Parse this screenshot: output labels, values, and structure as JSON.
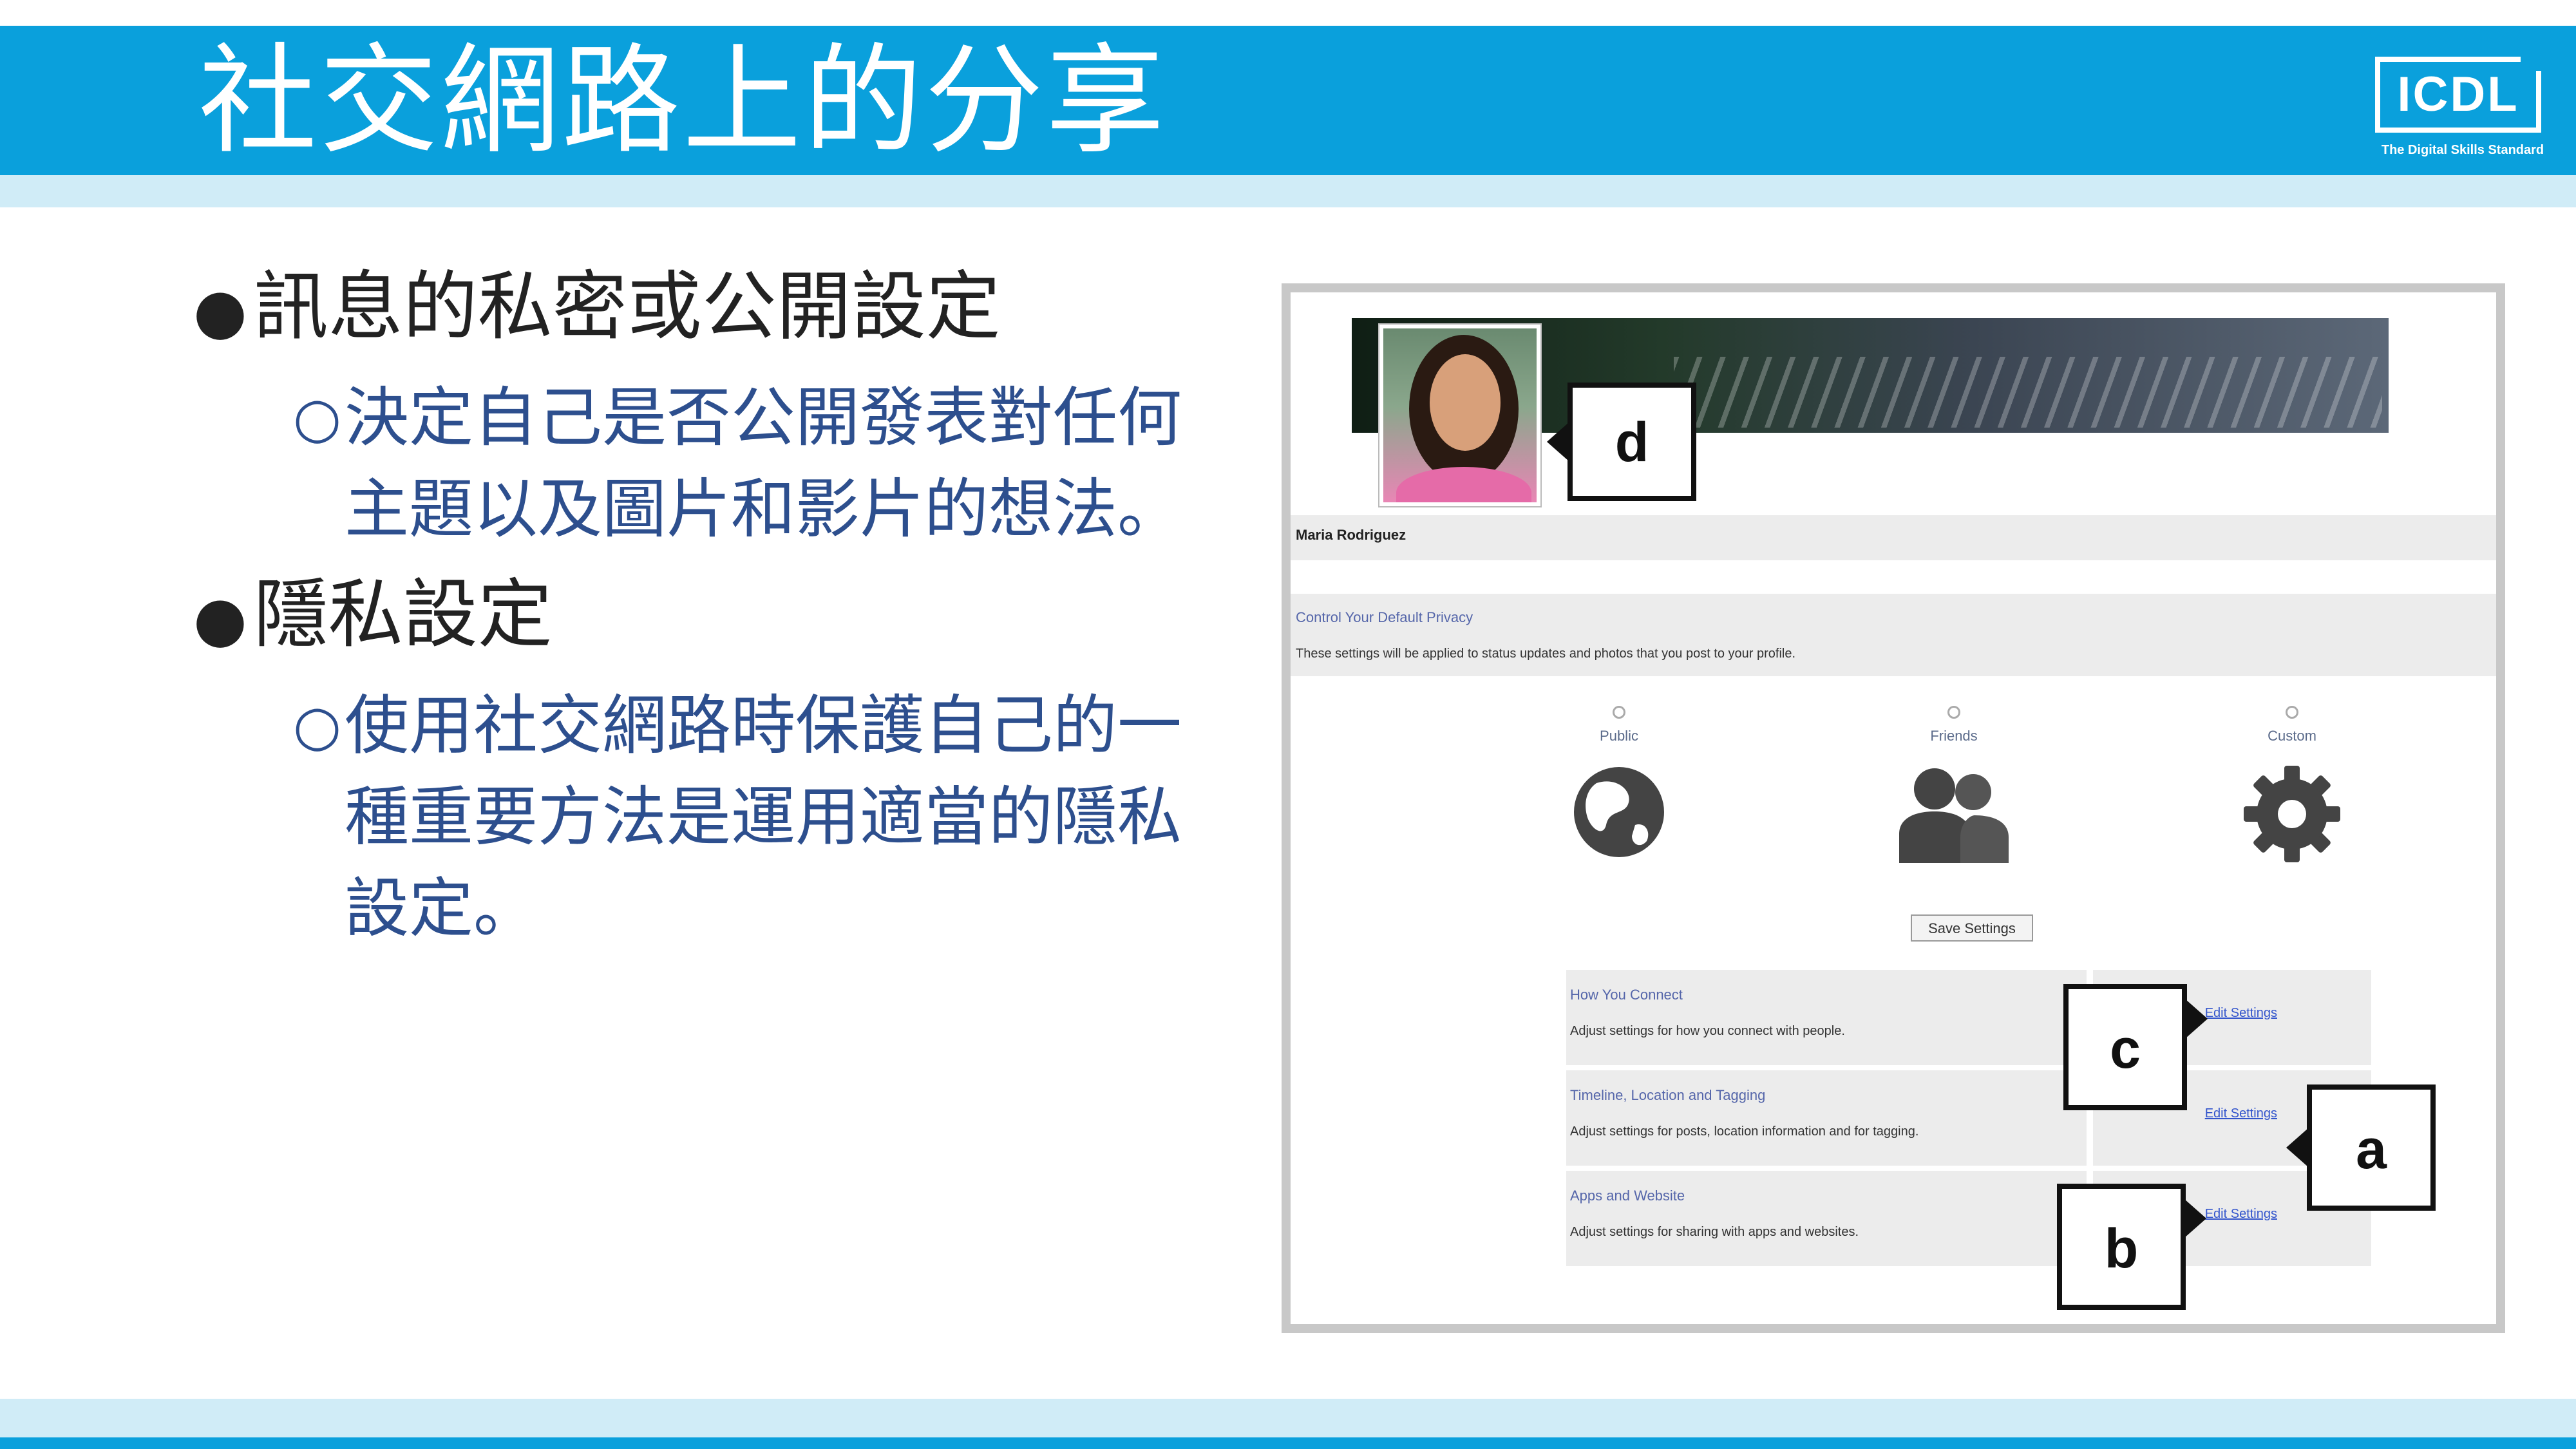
{
  "slide": {
    "title": "社交網路上的分享",
    "logo": {
      "text": "ICDL",
      "tagline": "The Digital Skills Standard"
    },
    "bullets": [
      {
        "text": "訊息的私密或公開設定",
        "sub": [
          "決定自己是否公開發表對任何",
          "主題以及圖片和影片的想法。"
        ]
      },
      {
        "text": "隱私設定",
        "sub": [
          "使用社交網路時保護自己的一",
          "種重要方法是運用適當的隱私",
          "設定。"
        ]
      }
    ]
  },
  "screenshot": {
    "profile_name": "Maria Rodriguez",
    "privacy": {
      "title": "Control Your Default Privacy",
      "description": "These settings will be applied to status updates and photos that you post to your profile."
    },
    "options": [
      {
        "label": "Public",
        "icon": "globe-icon"
      },
      {
        "label": "Friends",
        "icon": "people-icon"
      },
      {
        "label": "Custom",
        "icon": "gear-icon"
      }
    ],
    "save_button": "Save Settings",
    "settings_rows": [
      {
        "title": "How You Connect",
        "description": "Adjust settings for how you connect with people.",
        "link": "Edit Settings"
      },
      {
        "title": "Timeline, Location and Tagging",
        "description": "Adjust settings for posts, location information and for tagging.",
        "link": "Edit Settings"
      },
      {
        "title": "Apps and Website",
        "description": "Adjust settings for sharing with apps and websites.",
        "link": "Edit Settings"
      }
    ],
    "callouts": {
      "a": "a",
      "b": "b",
      "c": "c",
      "d": "d"
    }
  }
}
